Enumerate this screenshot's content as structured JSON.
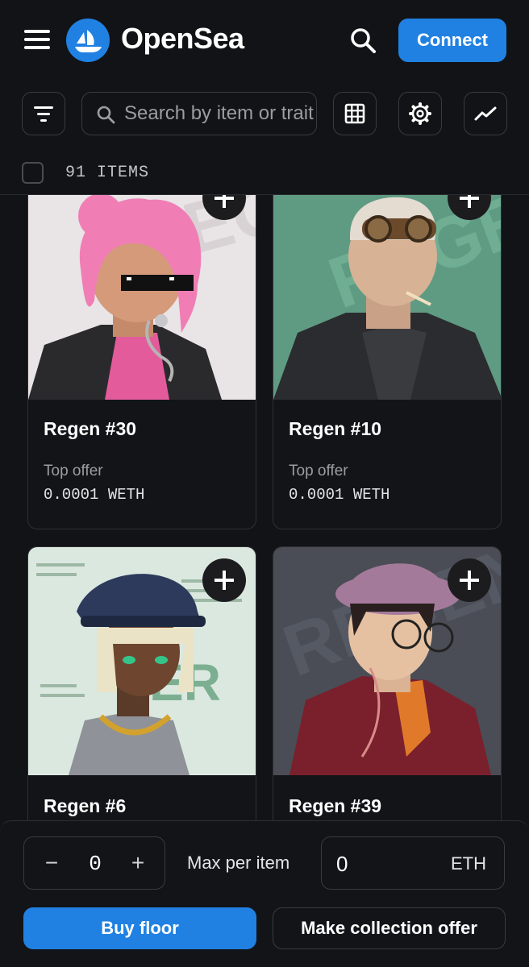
{
  "header": {
    "brand": "OpenSea",
    "connect_label": "Connect",
    "accent": "#2081e2"
  },
  "toolbar": {
    "search_placeholder": "Search by item or trait",
    "icons": [
      "filter-icon",
      "grid-view-icon",
      "settings-icon",
      "activity-chart-icon"
    ]
  },
  "collection": {
    "items_count": "91 ITEMS"
  },
  "cards": [
    {
      "title": "Regen #30",
      "offer_label": "Top offer",
      "offer_value": "0.0001 WETH",
      "bg": "#e9e4e6"
    },
    {
      "title": "Regen #10",
      "offer_label": "Top offer",
      "offer_value": "0.0001 WETH",
      "bg": "#5f9b83"
    },
    {
      "title": "Regen #6",
      "bg": "#dbe8df"
    },
    {
      "title": "Regen #39",
      "bg": "#4a4d55"
    }
  ],
  "bottom_bar": {
    "quantity": "0",
    "minus": "−",
    "plus": "+",
    "max_label": "Max per item",
    "price_value": "0",
    "price_unit": "ETH",
    "buy_label": "Buy floor",
    "offer_label": "Make collection offer"
  }
}
